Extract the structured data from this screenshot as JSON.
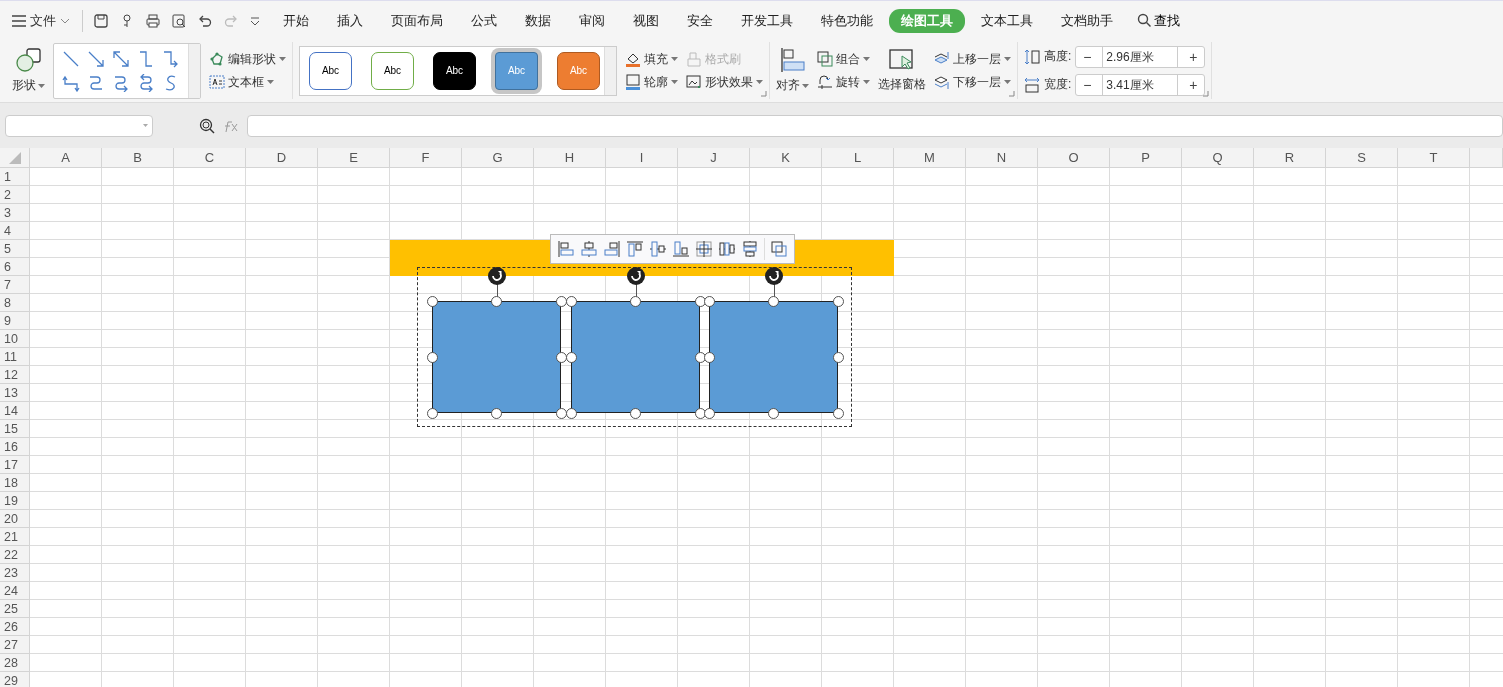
{
  "menu": {
    "label": "文件"
  },
  "tabs": [
    {
      "label": "开始",
      "selected": false
    },
    {
      "label": "插入",
      "selected": false
    },
    {
      "label": "页面布局",
      "selected": false
    },
    {
      "label": "公式",
      "selected": false
    },
    {
      "label": "数据",
      "selected": false
    },
    {
      "label": "审阅",
      "selected": false
    },
    {
      "label": "视图",
      "selected": false
    },
    {
      "label": "安全",
      "selected": false
    },
    {
      "label": "开发工具",
      "selected": false
    },
    {
      "label": "特色功能",
      "selected": false
    },
    {
      "label": "绘图工具",
      "selected": true
    },
    {
      "label": "文本工具",
      "selected": false
    },
    {
      "label": "文档助手",
      "selected": false
    }
  ],
  "search": {
    "label": "查找"
  },
  "ribbon": {
    "shapes": "形状",
    "edit_shape": "编辑形状",
    "textbox": "文本框",
    "styles": [
      {
        "label": "Abc",
        "fill": {
          "color": "#ffffff"
        },
        "line": {
          "color": "#4472c4"
        },
        "selected": false
      },
      {
        "label": "Abc",
        "fill": {
          "color": "#ffffff"
        },
        "line": {
          "color": "#70ad47"
        },
        "selected": false
      },
      {
        "label": "Abc",
        "fill": {
          "color": "#000000"
        },
        "line": {
          "color": "#000000"
        },
        "selected": false
      },
      {
        "label": "Abc",
        "fill": {
          "color": "#5b9bd5"
        },
        "line": {
          "color": "#41719c"
        },
        "selected": true
      },
      {
        "label": "Abc",
        "fill": {
          "color": "#ed7d31"
        },
        "line": {
          "color": "#ae5a21"
        },
        "selected": false
      }
    ],
    "fill": "填充",
    "format_painter": {
      "label": "格式刷",
      "disabled": true
    },
    "outline": "轮廓",
    "shape_effect": "形状效果",
    "align": "对齐",
    "group": "组合",
    "rotate": "旋转",
    "selection_pane": "选择窗格",
    "bring_forward": "上移一层",
    "send_backward": "下移一层",
    "height": {
      "label": "高度:",
      "value": "2.96厘米",
      "decrement": "−",
      "increment": "+"
    },
    "width": {
      "label": "宽度:",
      "value": "3.41厘米",
      "decrement": "−",
      "increment": "+"
    }
  },
  "sheet": {
    "columns": [
      "A",
      "B",
      "C",
      "D",
      "E",
      "F",
      "G",
      "H",
      "I",
      "J",
      "K",
      "L",
      "M",
      "N",
      "O",
      "P",
      "Q",
      "R",
      "S",
      "T"
    ],
    "rows": [
      "1",
      "2",
      "3",
      "4",
      "5",
      "6",
      "7",
      "8",
      "9",
      "10",
      "11",
      "12",
      "13",
      "14",
      "15",
      "16",
      "17",
      "18",
      "19",
      "20",
      "21",
      "22",
      "23",
      "24",
      "25",
      "26",
      "27",
      "28",
      "29"
    ],
    "banner": {
      "color": "#ffc000"
    },
    "shapes": [
      {
        "kind": "rectangle",
        "color": "#5b9bd5",
        "selected": true
      },
      {
        "kind": "rectangle",
        "color": "#5b9bd5",
        "selected": true
      },
      {
        "kind": "rectangle",
        "color": "#5b9bd5",
        "selected": true
      }
    ]
  }
}
